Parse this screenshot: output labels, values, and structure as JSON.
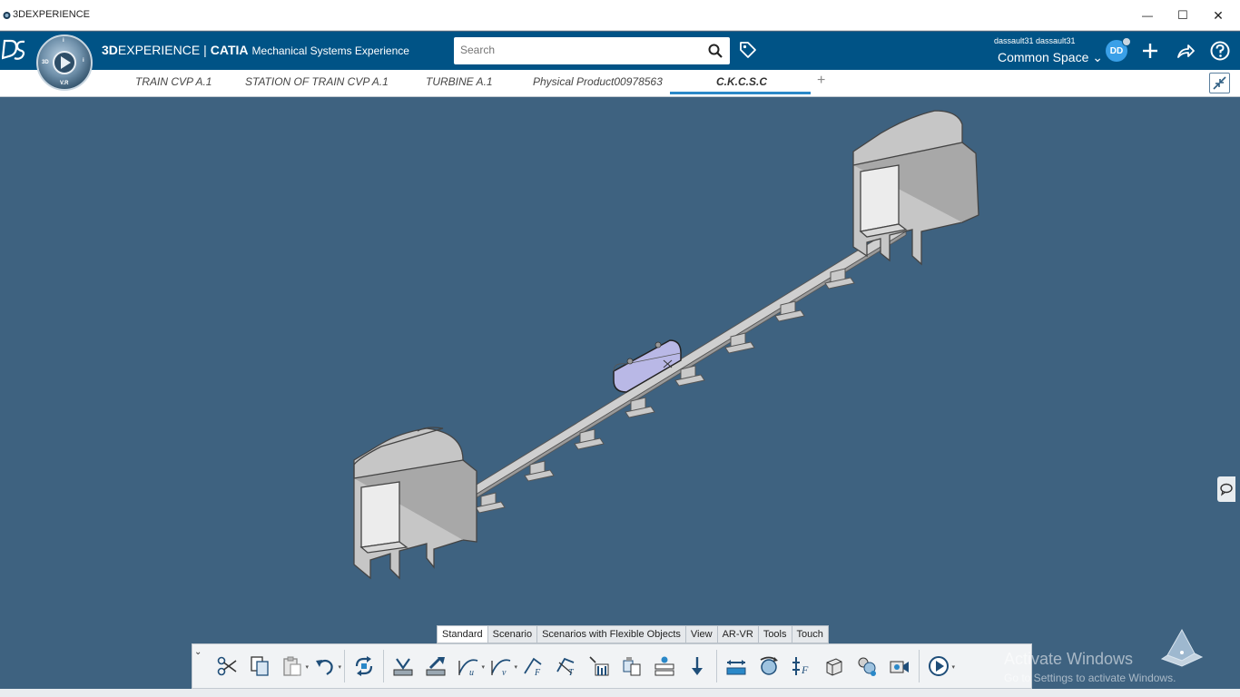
{
  "window": {
    "title": "3DEXPERIENCE",
    "minimize_glyph": "—",
    "maximize_glyph": "☐",
    "close_glyph": "✕"
  },
  "header": {
    "brand_prefix": "3D",
    "brand_main": "EXPERIENCE",
    "brand_separator": "|",
    "brand_product": "CATIA",
    "app_name": "Mechanical Systems Experience",
    "compass_labels": {
      "top": "i",
      "left": "3D",
      "right": "i",
      "bottom": "V.R"
    },
    "search_placeholder": "Search",
    "user_name": "dassault31 dassault31",
    "space_name": "Common Space",
    "space_chevron": "⌄",
    "avatar_initials": "DD",
    "icons": [
      "ds-logo-icon",
      "compass-icon",
      "search-icon",
      "tag-icon",
      "plus-icon",
      "share-icon",
      "help-icon"
    ]
  },
  "tabs": [
    {
      "label": "TRAIN CVP A.1",
      "active": false
    },
    {
      "label": "STATION OF TRAIN CVP A.1",
      "active": false
    },
    {
      "label": "TURBINE A.1",
      "active": false
    },
    {
      "label": "Physical Product00978563",
      "active": false
    },
    {
      "label": "C.K.C.S.C",
      "active": true
    }
  ],
  "tab_add_glyph": "+",
  "colors": {
    "header_bg": "#005386",
    "viewport_bg": "#3e6280",
    "active_tab_underline": "#2a88c8",
    "train_body": "#b9b8e6",
    "concrete": "#c8c8c8"
  },
  "toolbar": {
    "tabs": [
      {
        "label": "Standard",
        "active": true
      },
      {
        "label": "Scenario",
        "active": false
      },
      {
        "label": "Scenarios with Flexible Objects",
        "active": false
      },
      {
        "label": "View",
        "active": false
      },
      {
        "label": "AR-VR",
        "active": false
      },
      {
        "label": "Tools",
        "active": false
      },
      {
        "label": "Touch",
        "active": false
      }
    ],
    "collapse_glyph": "⌄",
    "dropdown_glyph": "▾",
    "icons": [
      "cut-icon",
      "copy-icon",
      "paste-icon",
      "undo-icon",
      "update-icon",
      "snap-icon",
      "align-icon",
      "u-direction-icon",
      "v-direction-icon",
      "f-curve-icon",
      "t-curve-icon",
      "measure-icon",
      "assembly-icon",
      "bom-icon",
      "down-arrow-icon",
      "ruler-icon",
      "rotate-part-icon",
      "flex-icon",
      "box-icon",
      "cluster-icon",
      "camera-icon",
      "play-icon"
    ]
  },
  "watermark": {
    "line1": "Activate Windows",
    "line2": "Go to Settings to activate Windows."
  }
}
